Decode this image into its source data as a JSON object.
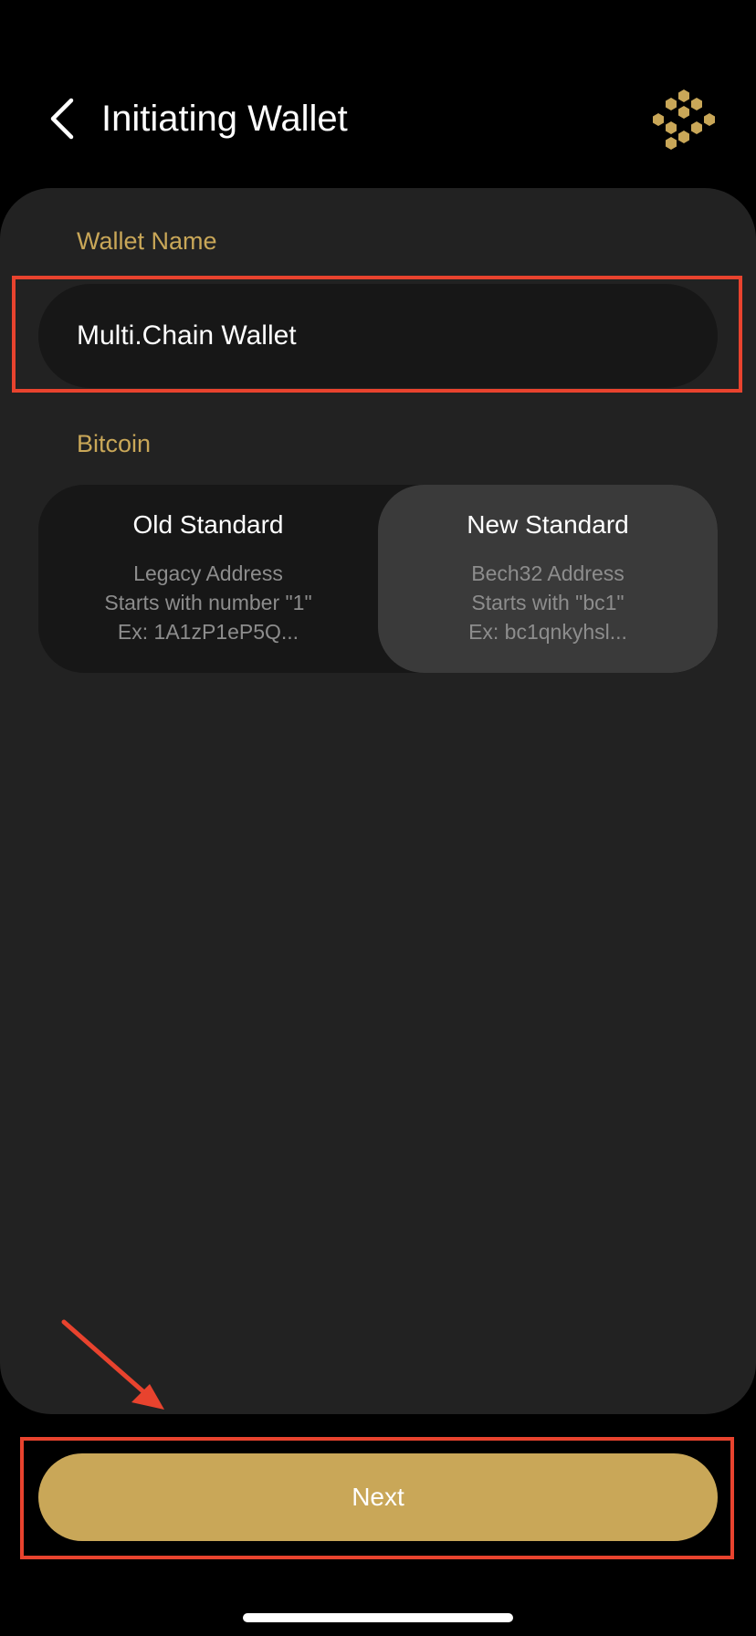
{
  "header": {
    "title": "Initiating Wallet",
    "back_icon": "chevron-left-icon",
    "logo_icon": "hexagon-cluster-logo"
  },
  "wallet_name": {
    "label": "Wallet Name",
    "value": "Multi.Chain Wallet"
  },
  "bitcoin": {
    "label": "Bitcoin",
    "options": [
      {
        "title": "Old Standard",
        "line1": "Legacy Address",
        "line2": "Starts with number \"1\"",
        "line3": "Ex: 1A1zP1eP5Q...",
        "selected": false
      },
      {
        "title": "New Standard",
        "line1": "Bech32 Address",
        "line2": "Starts with \"bc1\"",
        "line3": "Ex: bc1qnkyhsl...",
        "selected": true
      }
    ]
  },
  "next_button": {
    "label": "Next"
  },
  "colors": {
    "background": "#000000",
    "card": "#222222",
    "input": "#171717",
    "selected_segment": "#3a3a3a",
    "accent_gold": "#c9a758",
    "annotation_red": "#e8432e",
    "muted_text": "#8d8d8d"
  }
}
